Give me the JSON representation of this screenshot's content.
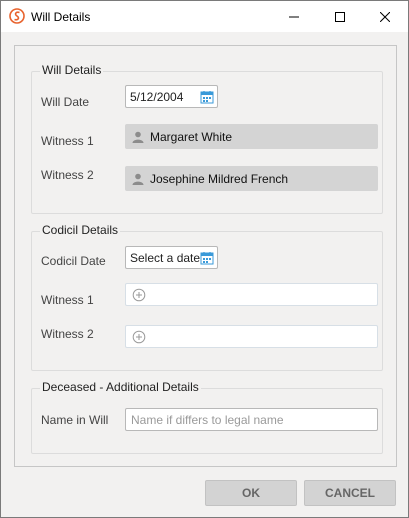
{
  "window": {
    "title": "Will Details",
    "controls": {
      "minimize": "minimize",
      "maximize": "maximize",
      "close": "close"
    }
  },
  "will_details": {
    "title": "Will Details",
    "will_date_label": "Will Date",
    "will_date_value": "5/12/2004",
    "witness1_label": "Witness 1",
    "witness1_name": "Margaret White",
    "witness2_label": "Witness 2",
    "witness2_name": "Josephine Mildred French"
  },
  "codicil_details": {
    "title": "Codicil Details",
    "codicil_date_label": "Codicil Date",
    "codicil_date_placeholder": "Select a date",
    "witness1_label": "Witness 1",
    "witness2_label": "Witness 2"
  },
  "deceased_details": {
    "title": "Deceased - Additional Details",
    "name_in_will_label": "Name in Will",
    "name_in_will_placeholder": "Name if differs to legal name",
    "name_in_will_value": ""
  },
  "footer": {
    "ok_label": "OK",
    "cancel_label": "CANCEL"
  },
  "icons": {
    "app": "app-logo-icon",
    "calendar": "calendar-icon",
    "person": "person-icon",
    "add": "plus-circle-icon"
  },
  "colors": {
    "accent": "#e8622c",
    "calendar": "#3a9ad9",
    "button_bg": "#d3d3d3",
    "person_field_bg": "#d4d4d4"
  }
}
